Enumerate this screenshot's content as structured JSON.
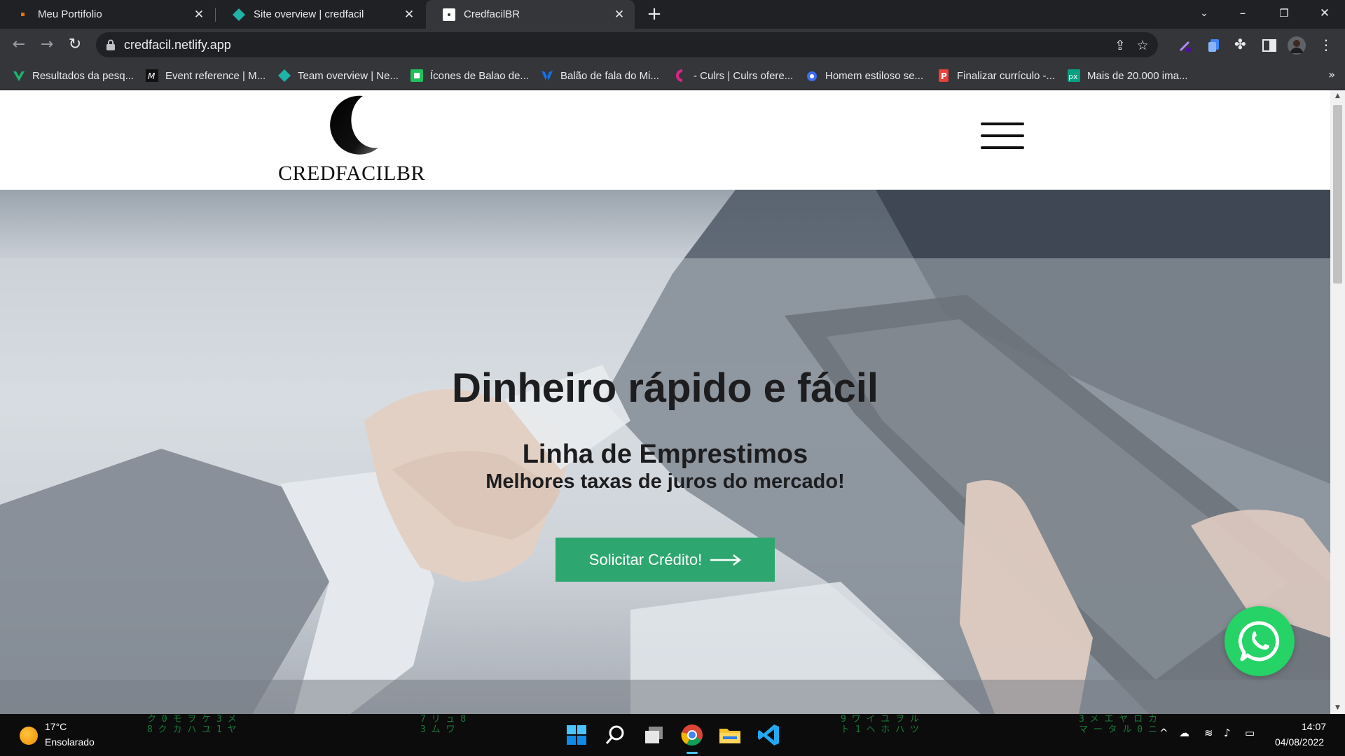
{
  "browser": {
    "tabs": [
      {
        "title": "Meu Portifolio"
      },
      {
        "title": "Site overview | credfacil"
      },
      {
        "title": "CredfacilBR"
      }
    ],
    "active_tab_index": 2,
    "url": "credfacil.netlify.app",
    "bookmarks": [
      {
        "label": "Resultados da pesq...",
        "icon": "vuetify-icon"
      },
      {
        "label": "Event reference | M...",
        "icon": "mdn-icon"
      },
      {
        "label": "Team overview | Ne...",
        "icon": "netlify-icon"
      },
      {
        "label": "Ícones de Balao de...",
        "icon": "flaticon-icon"
      },
      {
        "label": "Balão de fala do Mi...",
        "icon": "freepik-icon"
      },
      {
        "label": "- Culrs | Culrs ofere...",
        "icon": "culrs-icon"
      },
      {
        "label": "Homem estiloso se...",
        "icon": "dribbble-icon"
      },
      {
        "label": "Finalizar currículo -...",
        "icon": "resume-icon"
      },
      {
        "label": "Mais de 20.000 ima...",
        "icon": "pexels-icon"
      }
    ]
  },
  "site": {
    "logo_text": "CREDFACILBR",
    "hero": {
      "title": "Dinheiro rápido e fácil",
      "subtitle": "Linha de Emprestimos",
      "tagline": "Melhores taxas de juros do mercado!",
      "cta_label": "Solicitar Crédito!"
    },
    "colors": {
      "cta": "#2ea66f",
      "whatsapp": "#25d366"
    }
  },
  "taskbar": {
    "weather_temp": "17°C",
    "weather_desc": "Ensolarado",
    "time": "14:07",
    "date": "04/08/2022"
  }
}
